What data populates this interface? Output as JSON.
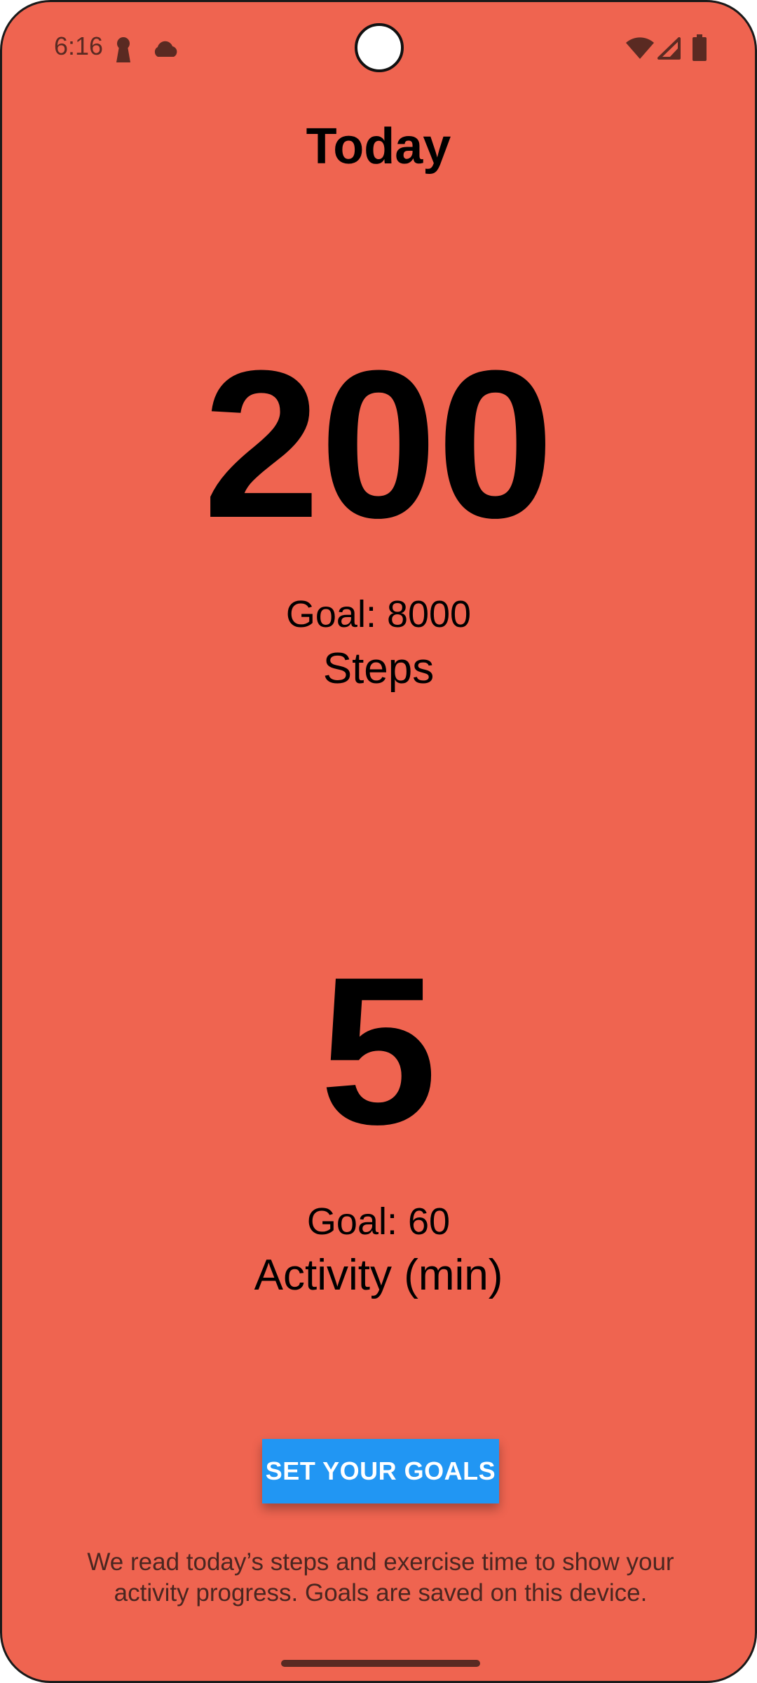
{
  "status_bar": {
    "time": "6:16",
    "left_icons": [
      "keyhole-icon",
      "cloud-icon"
    ],
    "right_icons": [
      "wifi-icon",
      "cell-signal-icon",
      "battery-icon"
    ]
  },
  "header": {
    "title": "Today"
  },
  "steps": {
    "value": "200",
    "goal": "Goal: 8000",
    "label": "Steps"
  },
  "activity": {
    "value": "5",
    "goal": "Goal: 60",
    "label": "Activity (min)"
  },
  "actions": {
    "set_goals_label": "SET YOUR GOALS"
  },
  "footer": {
    "disclaimer": "We read today’s steps and exercise time to show your activity progress. Goals are saved on this device."
  },
  "colors": {
    "background": "#ef6450",
    "button": "#2196f3",
    "button_text": "#ffffff",
    "text": "#000000"
  }
}
